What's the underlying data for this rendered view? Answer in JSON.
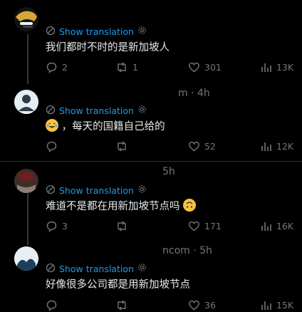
{
  "common": {
    "translate_label": "Show translation"
  },
  "tweets": [
    {
      "handle": "",
      "text": "我们都时不时的是新加坡人",
      "emoji": "",
      "reply_count": "2",
      "retweet_count": "1",
      "like_count": "301",
      "view_count": "13K"
    },
    {
      "handle": "m · 4h",
      "text": "，每天的国籍自己给的",
      "emoji": "😂",
      "reply_count": "",
      "retweet_count": "",
      "like_count": "52",
      "view_count": "12K"
    },
    {
      "handle": "5h",
      "text": "难道不是都在用新加坡节点吗",
      "emoji": "🙃",
      "reply_count": "3",
      "retweet_count": "",
      "like_count": "171",
      "view_count": "16K"
    },
    {
      "handle": "ncom · 5h",
      "text": "好像很多公司都是用新加坡节点",
      "emoji": "",
      "reply_count": "",
      "retweet_count": "",
      "like_count": "36",
      "view_count": "15K"
    }
  ],
  "colors": {
    "accent": "#1d9bf0",
    "muted": "#71767b",
    "text": "#e7e9ea",
    "bg": "#000000"
  },
  "icons": [
    "globe-translate-icon",
    "gear-icon",
    "reply-icon",
    "retweet-icon",
    "like-icon",
    "views-icon"
  ]
}
